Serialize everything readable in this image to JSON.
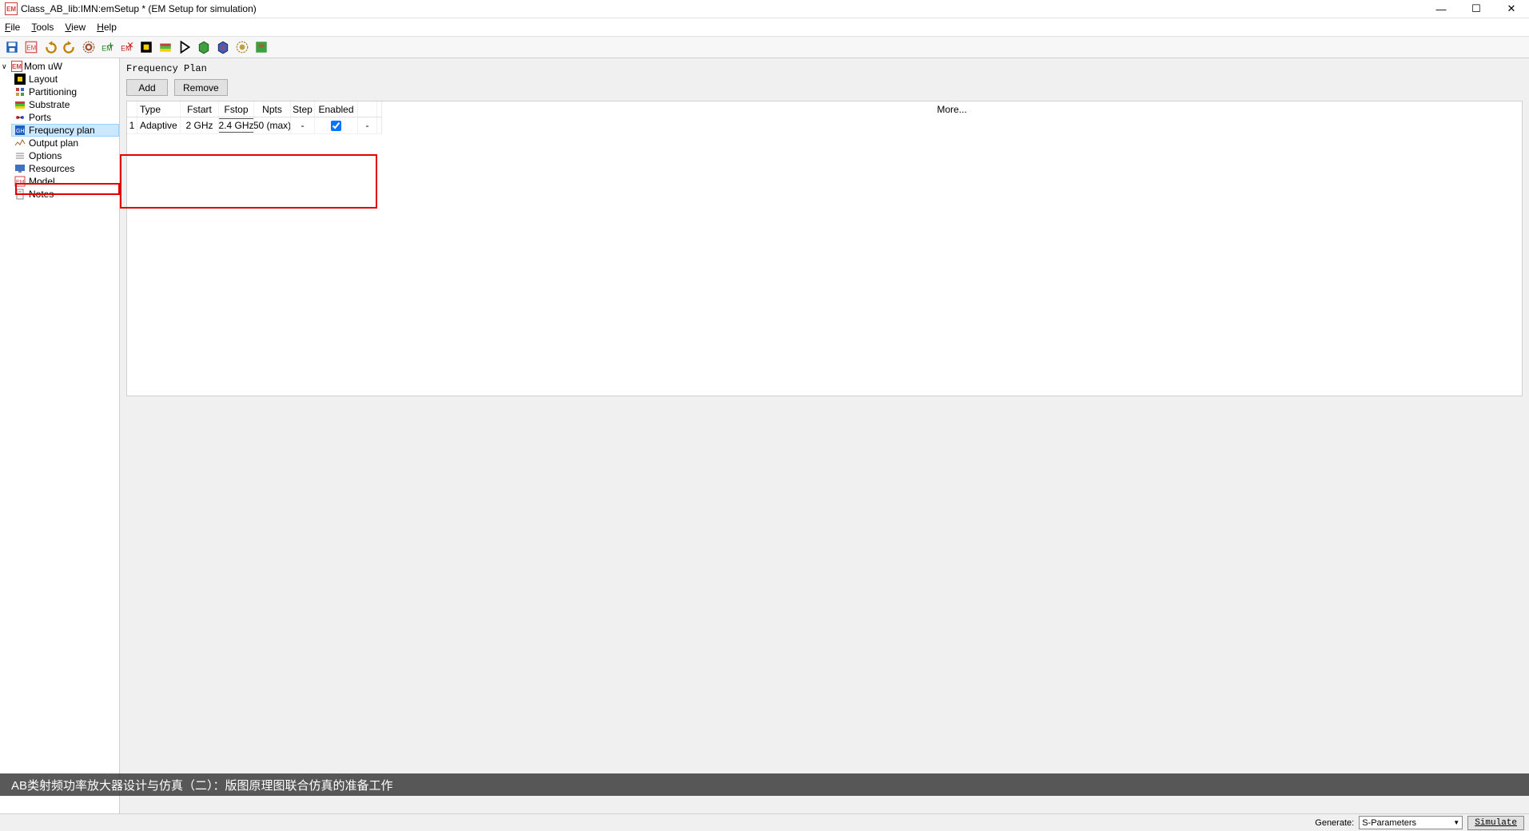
{
  "window": {
    "title": "Class_AB_lib:IMN:emSetup * (EM Setup for simulation)"
  },
  "menu": {
    "file": "File",
    "tools": "Tools",
    "view": "View",
    "help": "Help"
  },
  "sidebar": {
    "root": "Mom uW",
    "items": [
      "Layout",
      "Partitioning",
      "Substrate",
      "Ports",
      "Frequency plan",
      "Output plan",
      "Options",
      "Resources",
      "Model",
      "Notes"
    ]
  },
  "panel": {
    "title": "Frequency Plan",
    "btn_add": "Add",
    "btn_remove": "Remove",
    "more": "More..."
  },
  "table": {
    "headers": [
      "",
      "Type",
      "Fstart",
      "Fstop",
      "Npts",
      "Step",
      "Enabled",
      ""
    ],
    "rows": [
      {
        "idx": "1",
        "type": "Adaptive",
        "fstart": "2 GHz",
        "fstop": "2.4 GHz",
        "npts": "50 (max)",
        "step": "-",
        "enabled": true,
        "last": "-"
      }
    ]
  },
  "status": {
    "generate_label": "Generate:",
    "generate_value": "S-Parameters",
    "simulate": "Simulate"
  },
  "caption": "AB类射频功率放大器设计与仿真（二）：版图原理图联合仿真的准备工作"
}
